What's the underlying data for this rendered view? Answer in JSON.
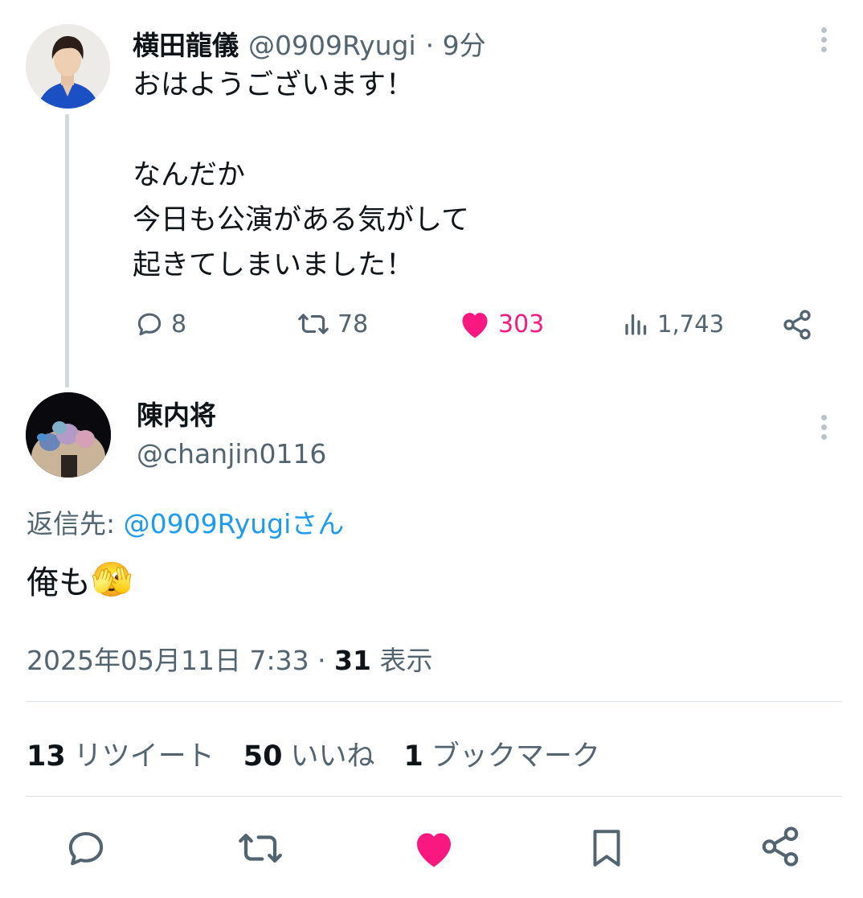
{
  "parent_tweet": {
    "display_name": "横田龍儀",
    "handle": "@0909Ryugi",
    "time": "· 9分",
    "text": "おはようございます！\n\nなんだか\n今日も公演がある気がして\n起きてしまいました！",
    "replies": "8",
    "retweets": "78",
    "likes": "303",
    "views": "1,743"
  },
  "reply_tweet": {
    "display_name": "陳内将",
    "handle": "@chanjin0116",
    "reply_prefix": "返信先: ",
    "reply_target": "@0909Ryugiさん",
    "text": "俺も",
    "emoji": "🫣",
    "timestamp": "2025年05月11日 7:33 · ",
    "view_count": "31",
    "view_label": " 表示"
  },
  "stats": {
    "retweets_count": "13",
    "retweets_label": "リツイート",
    "likes_count": "50",
    "likes_label": "いいね",
    "bookmarks_count": "1",
    "bookmarks_label": "ブックマーク"
  },
  "colors": {
    "like_pink": "#f91880",
    "link_blue": "#1d9bf0",
    "muted": "#536471"
  },
  "icons": [
    "reply-icon",
    "retweet-icon",
    "like-icon",
    "views-icon",
    "share-icon",
    "bookmark-icon",
    "more-icon"
  ]
}
